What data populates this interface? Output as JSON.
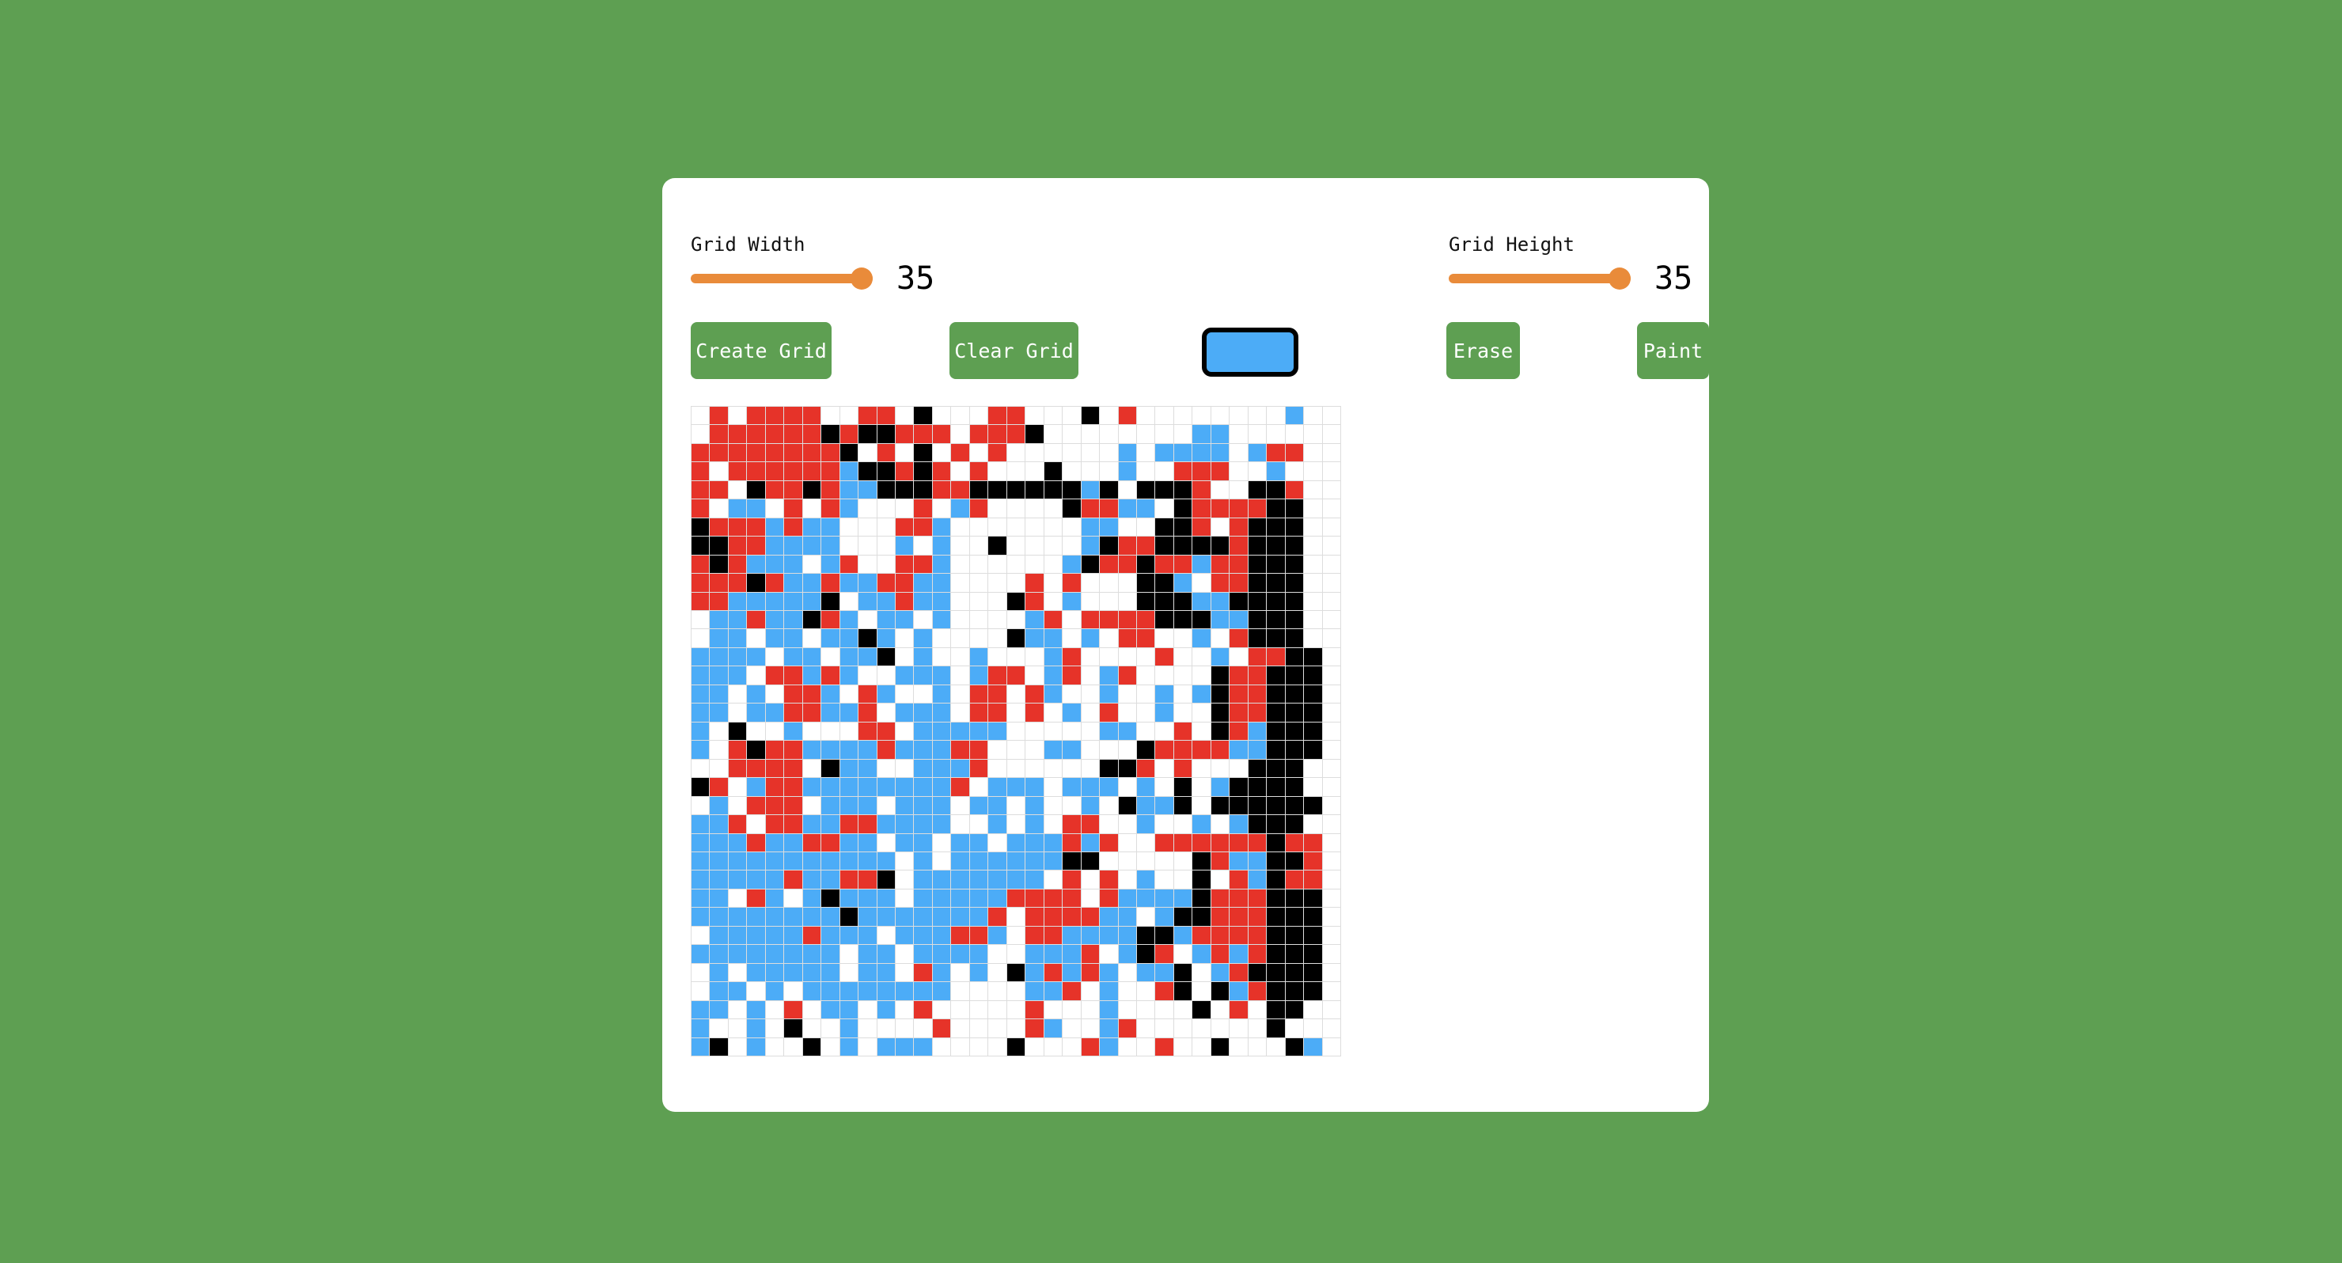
{
  "controls": {
    "width_label": "Grid Width",
    "width_value": "35",
    "width_fraction": 1.0,
    "height_label": "Grid Height",
    "height_value": "35",
    "height_fraction": 1.0
  },
  "toolbar": {
    "create_label": "Create Grid",
    "clear_label": "Clear Grid",
    "erase_label": "Erase",
    "paint_label": "Paint",
    "selected_color": "#4cacf7"
  },
  "grid": {
    "columns": 35,
    "rows": 35,
    "palette": {
      "W": "#ffffff",
      "R": "#e63329",
      "B": "#4cacf7",
      "K": "#000000"
    },
    "cells": [
      "WRWRRRRWWRRWKWWWRRWWWKWRWWWWWWWWBWW",
      "WRRRRRRKRKKRRRWRRRKWWWWWWWWBBWWWWWW",
      "RRRRRRRRKWRWKWRWRWWWWWWBWBBBBWBRRWW",
      "RWRRRRRRBKKRKRWRWWWKWWWBWWRRRWWBWWW",
      "RRWKRRKRBBKKKRRKKKKKKBKWKKKRWWKKRWW",
      "RWBBWRWRBWWWRWBRWWWWKRRBBWKRRRRKKWW",
      "KRRRBRBBWWWRRBWWWWWWWBBWWKKRWRKKKWW",
      "KKRRBBBBWWWBWBWWKWWWWBKRRKKKKRKKKWW",
      "RKRBBBWBRWWRRBWWWWWWBKRRKRRBRRKKKWW",
      "RRRKRBBRBBRRBBWWWWRWRWWWKKBWRRKKKWW",
      "RRBBBBBKWBBRBBWWWKRWBWWWKKKBBKKKKWW",
      "WBBRBBKRBWBBWBWWWWBRWRRRRKKKBBKKKWW",
      "WBBWBBWBBKBWBWWWWKBBWBWRRWWBWRKKKWW",
      "BBBBWBBWBBKWBWWBWWWBRWWWWRWWBWRRKKW",
      "BBBWRRBRBWWBBBWBRRWBRWBRWWWWKRRKKKW",
      "BBWBWRRBWRBWWBWRRWRBWWBWWBWBKRRKKKW",
      "BBWBBRRBBRWBBBWRRWRWBWRWWBWWKRRKKKW",
      "BWKWWBWWWRRWBBBBBWWWWWBBWWRWKRBKKKW",
      "BWRKRRBBBBRBBBRRWWWBBWWWKRRRRBBKKKW",
      "WWRRRRWKBBWWBBBRWWWWWWKKRWRWWWKKKWW",
      "KRWBRRBBBBBBBBRWBBBWBBBWBWKWBKKKKWW",
      "WBWRRRWBBBWBBBWBBWBWWBWKBBKWKKKKKKW",
      "BBRWRRBBRRBBBBWWBWBWRRWWBWWBWBKKKWW",
      "BBBRBBRRBBWBBWBBWBBBRBRWWRRRRRRKRRW",
      "BBBBBBBBBBBWBWBBBBBBKKWWWWWKRBBKKRW",
      "BBBBBRBBRRKWBBBBBBBWRWRWBWWKWRBKRRW",
      "BBWRBWBKBBBWBBBBBRRRRWRBBBBKRRRKKKW",
      "BBBBBBBBKBBBBBBBRWRRRRBBWBKKRRRKKKW",
      "WBBBBBRBBBWBBBRRBWRRBBBBKKBRRRRKKKW",
      "BBBBBBBBWBBWBBBBWWBBBRWBKRWBRBRKKKW",
      "WBWBBBBBWBBWRBWBWKBRBRBWBBKWBRKKKKW",
      "WBBWBWBBBBBBBBWWWWBBRWBWWRKWKBRKKKW",
      "BBWBWRWBBWBWRWWWWWRWWWBWWWWKWRWKKWW",
      "BWWBWKWWBWWWWRWWWWRBWWBRWWWWWWWKWWW",
      "BKWBWWKWBWBBBWWWWKWWWRBWWRWWKWWWKBW"
    ]
  }
}
